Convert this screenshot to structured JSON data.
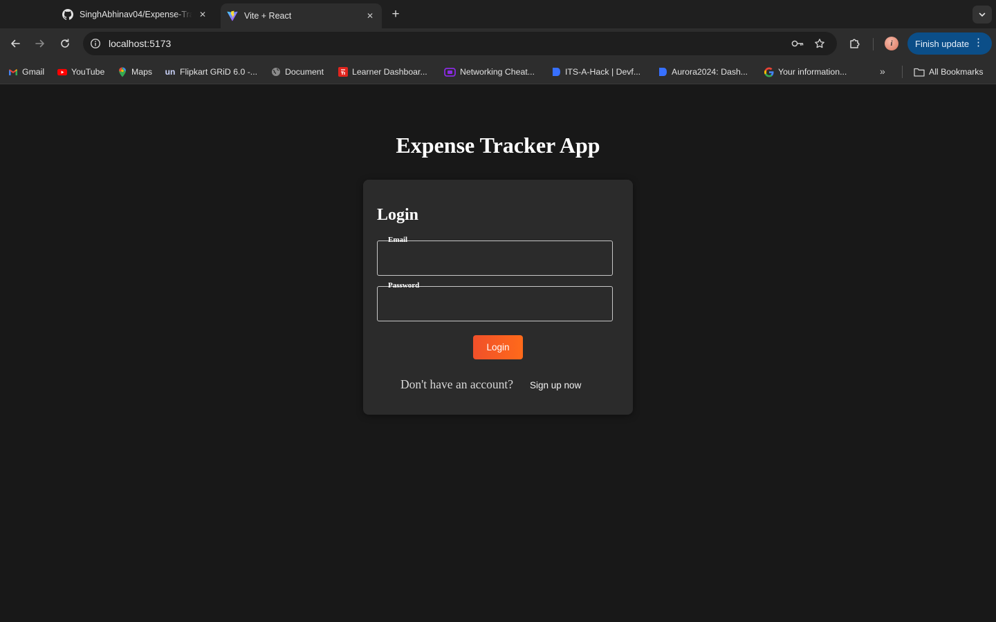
{
  "browser": {
    "tabs": [
      {
        "title": "SinghAbhinav04/Expense-Tracker",
        "icon": "github-icon",
        "active": false
      },
      {
        "title": "Vite + React",
        "icon": "vite-icon",
        "active": true
      }
    ],
    "url": "localhost:5173",
    "finish_update_label": "Finish update",
    "avatar_initial": "i",
    "bookmarks": [
      {
        "label": "Gmail",
        "icon": "gmail-icon"
      },
      {
        "label": "YouTube",
        "icon": "youtube-icon"
      },
      {
        "label": "Maps",
        "icon": "maps-icon"
      },
      {
        "label": "Flipkart GRiD 6.0 -...",
        "icon": "unstop-icon"
      },
      {
        "label": "Document",
        "icon": "globe-icon"
      },
      {
        "label": "Learner Dashboar...",
        "icon": "learner-icon"
      },
      {
        "label": "Networking Cheat...",
        "icon": "networking-icon"
      },
      {
        "label": "ITS-A-Hack | Devf...",
        "icon": "devfolio-icon"
      },
      {
        "label": "Aurora2024: Dash...",
        "icon": "devfolio-icon"
      },
      {
        "label": "Your information...",
        "icon": "google-icon"
      }
    ],
    "all_bookmarks_label": "All Bookmarks",
    "more_bookmarks_glyph": "»"
  },
  "app": {
    "title": "Expense Tracker App",
    "login": {
      "heading": "Login",
      "email_label": "Email",
      "email_value": "",
      "password_label": "Password",
      "password_value": "",
      "submit_label": "Login",
      "no_account_text": "Don't have an account?",
      "signup_link": "Sign up now"
    }
  },
  "colors": {
    "page_bg": "#181818",
    "card_bg": "#2b2b2b",
    "button_start": "#f0502a",
    "button_end": "#ff6a1a",
    "finish_update_bg": "#0b4e88"
  }
}
